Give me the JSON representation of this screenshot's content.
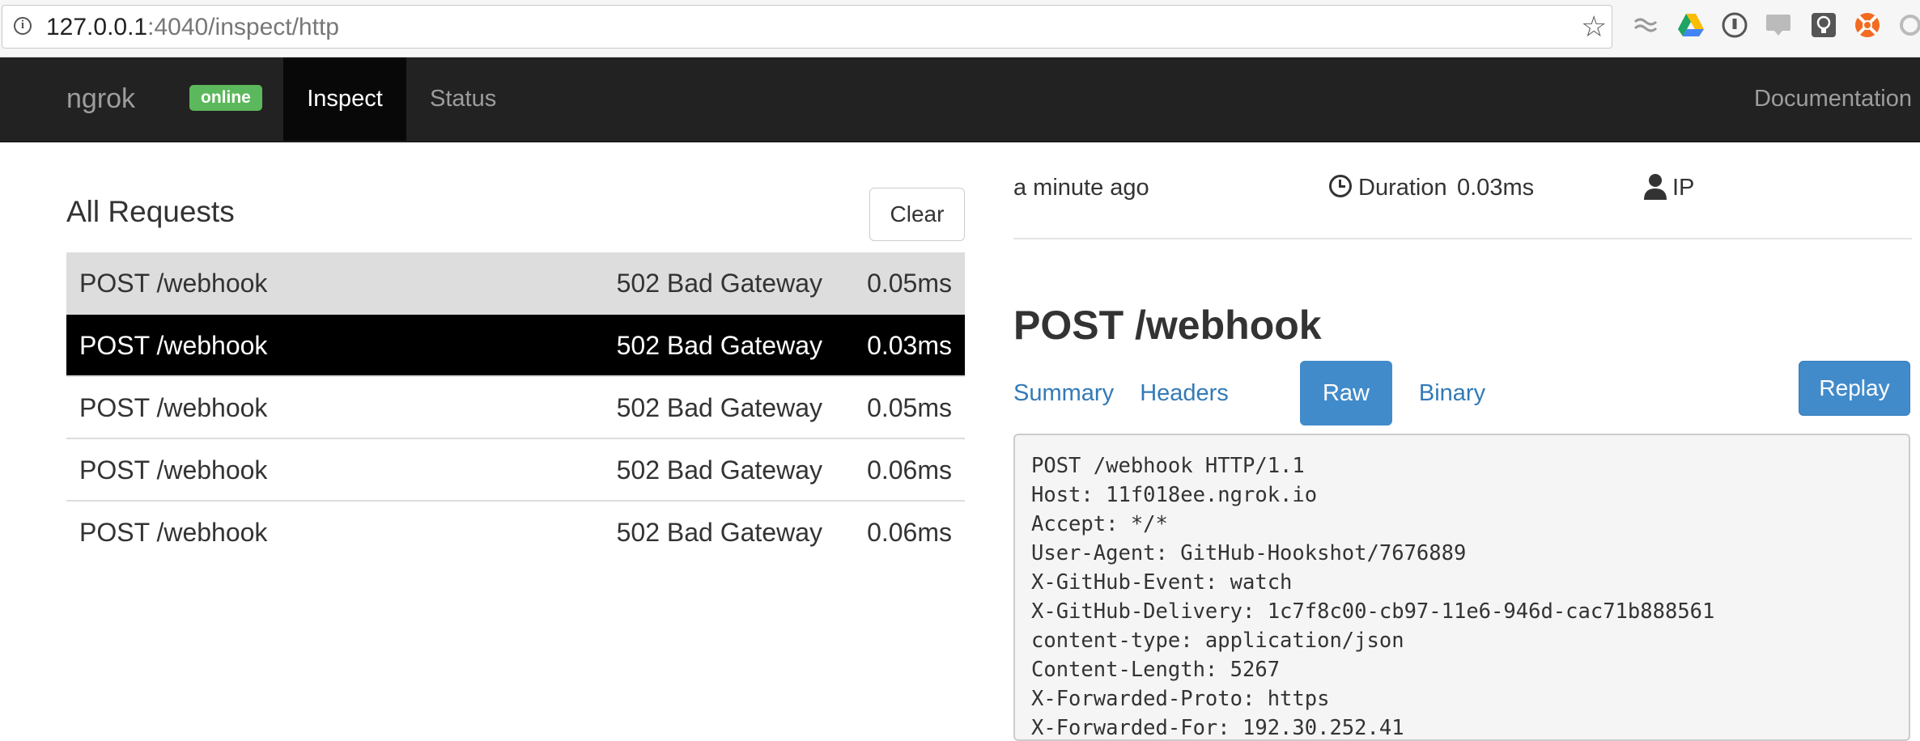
{
  "browser": {
    "url_host": "127.0.0.1",
    "url_rest": ":4040/inspect/http"
  },
  "navbar": {
    "brand": "ngrok",
    "badge": "online",
    "items": [
      {
        "label": "Inspect"
      },
      {
        "label": "Status"
      }
    ],
    "docs": "Documentation"
  },
  "requests": {
    "title": "All Requests",
    "clear_label": "Clear",
    "rows": [
      {
        "path": "POST /webhook",
        "status": "502 Bad Gateway",
        "duration": "0.05ms"
      },
      {
        "path": "POST /webhook",
        "status": "502 Bad Gateway",
        "duration": "0.03ms"
      },
      {
        "path": "POST /webhook",
        "status": "502 Bad Gateway",
        "duration": "0.05ms"
      },
      {
        "path": "POST /webhook",
        "status": "502 Bad Gateway",
        "duration": "0.06ms"
      },
      {
        "path": "POST /webhook",
        "status": "502 Bad Gateway",
        "duration": "0.06ms"
      }
    ]
  },
  "detail": {
    "time": "a minute ago",
    "duration_label": "Duration",
    "duration_value": "0.03ms",
    "ip_label": "IP",
    "title": "POST /webhook",
    "tabs": [
      {
        "label": "Summary"
      },
      {
        "label": "Headers"
      },
      {
        "label": "Raw"
      },
      {
        "label": "Binary"
      }
    ],
    "replay_label": "Replay",
    "raw_lines": [
      "POST /webhook HTTP/1.1",
      "Host: 11f018ee.ngrok.io",
      "Accept: */*",
      "User-Agent: GitHub-Hookshot/7676889",
      "X-GitHub-Event: watch",
      "X-GitHub-Delivery: 1c7f8c00-cb97-11e6-946d-cac71b888561",
      "content-type: application/json",
      "Content-Length: 5267",
      "X-Forwarded-Proto: https",
      "X-Forwarded-For: 192.30.252.41"
    ]
  },
  "colors": {
    "navbar_bg": "#222222",
    "badge_green": "#5cb85c",
    "primary_blue": "#428bca",
    "link_blue": "#337ab7",
    "selected_row": "#000000"
  }
}
